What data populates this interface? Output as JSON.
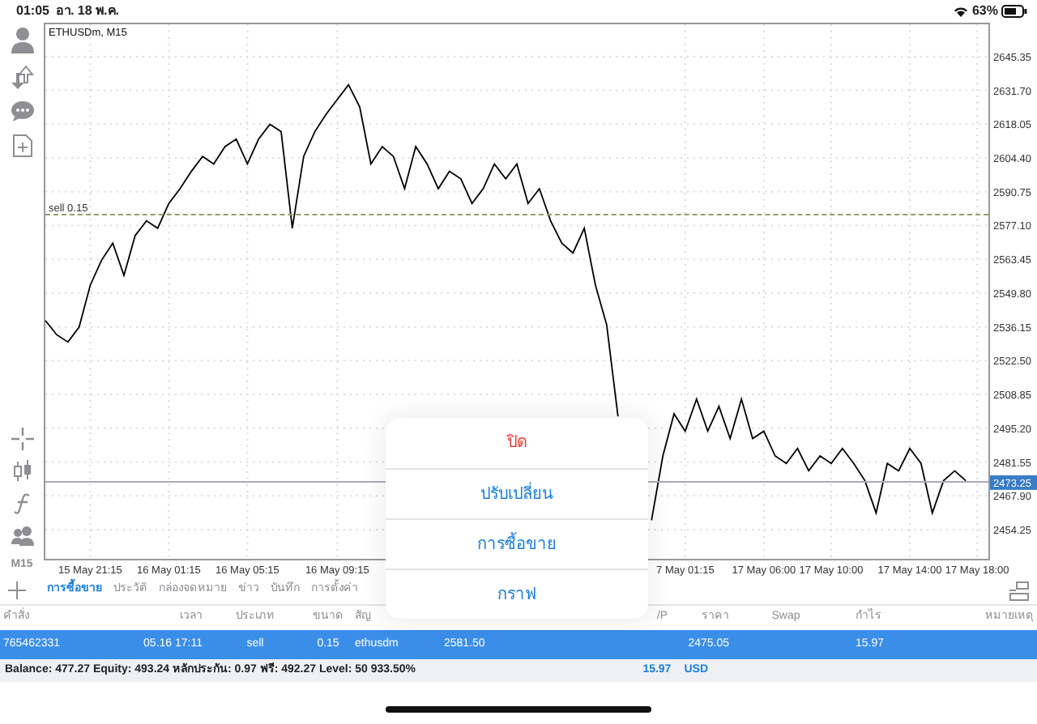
{
  "status_bar": {
    "time": "01:05",
    "date": "อา. 18 พ.ค.",
    "battery": "63%"
  },
  "toolbar": {
    "timeframe": "M15"
  },
  "chart": {
    "title": "ETHUSDm, M15",
    "order_label": "sell 0.15",
    "current_price": "2473.25",
    "chart_data": {
      "type": "line",
      "grid": true,
      "ylim": [
        2441.8,
        2658.4
      ],
      "categories": [
        null,
        null,
        null,
        null,
        "15 May 21:15",
        null,
        null,
        null,
        null,
        null,
        null,
        "16 May 01:15",
        null,
        null,
        null,
        null,
        null,
        null,
        "16 May 05:15",
        null,
        null,
        null,
        null,
        null,
        null,
        null,
        "16 May 09:15",
        null,
        null,
        null,
        null,
        null,
        null,
        null,
        null,
        null,
        null,
        null,
        null,
        null,
        null,
        null,
        null,
        null,
        null,
        null,
        null,
        null,
        null,
        null,
        null,
        null,
        null,
        null,
        null,
        null,
        null,
        "7 May 01:15",
        null,
        null,
        null,
        null,
        null,
        null,
        "17 May 06:00",
        null,
        null,
        null,
        null,
        null,
        "17 May 10:00",
        null,
        null,
        null,
        null,
        null,
        null,
        "17 May 14:00",
        null,
        null,
        null,
        null,
        null,
        "17 May 18:00"
      ],
      "yticks": [
        {
          "value": 2645.35,
          "label": "2645.35"
        },
        {
          "value": 2631.7,
          "label": "2631.70"
        },
        {
          "value": 2618.05,
          "label": "2618.05"
        },
        {
          "value": 2604.4,
          "label": "2604.40"
        },
        {
          "value": 2590.75,
          "label": "2590.75"
        },
        {
          "value": 2577.1,
          "label": "2577.10"
        },
        {
          "value": 2563.45,
          "label": "2563.45"
        },
        {
          "value": 2549.8,
          "label": "2549.80"
        },
        {
          "value": 2536.15,
          "label": "2536.15"
        },
        {
          "value": 2522.5,
          "label": "2522.50"
        },
        {
          "value": 2508.85,
          "label": "2508.85"
        },
        {
          "value": 2495.2,
          "label": "2495.20"
        },
        {
          "value": 2481.55,
          "label": "2481.55"
        },
        {
          "value": 2467.9,
          "label": "2467.90"
        },
        {
          "value": 2454.25,
          "label": "2454.25"
        }
      ],
      "series": [
        {
          "color": "#000000",
          "values": [
            2538.7,
            2533,
            2530,
            2536,
            2553,
            2563,
            2570,
            2557,
            2573,
            2579,
            2576,
            2586,
            2592,
            2599,
            2605,
            2602,
            2609,
            2612,
            2602,
            2612,
            2618,
            2615,
            2576,
            2605,
            2615,
            2622,
            2628,
            2634,
            2625,
            2602,
            2609,
            2605,
            2592,
            2609,
            2602,
            2592,
            2599,
            2596,
            2586,
            2592,
            2602,
            2596,
            2602,
            2586,
            2592,
            2579,
            2570,
            2566,
            2576,
            2553,
            2537,
            2500,
            null,
            null,
            2458,
            2484,
            2501,
            2494,
            2507,
            2494,
            2504,
            2491,
            2507,
            2491,
            2494,
            2484,
            2481,
            2487,
            2478,
            2484,
            2481,
            2487,
            2481,
            2474,
            2461,
            2481,
            2478,
            2487,
            2481,
            2461,
            2474,
            2478,
            2474,
            null
          ]
        }
      ]
    }
  },
  "tabs": [
    {
      "label": "การซื้อขาย",
      "selected": true
    },
    {
      "label": "ประวัติ",
      "selected": false
    },
    {
      "label": "กล่องจดหมาย",
      "selected": false
    },
    {
      "label": "ข่าว",
      "selected": false
    },
    {
      "label": "บันทึก",
      "selected": false
    },
    {
      "label": "การตั้งค่า",
      "selected": false
    }
  ],
  "table": {
    "columns": [
      "คำสั่ง",
      "เวลา",
      "ประเภท",
      "ขนาด",
      "สัญ",
      null,
      null,
      "/P",
      "ราคา",
      "Swap",
      "กำไร",
      "หมายเหตุ"
    ],
    "rows": [
      {
        "selected": true,
        "cells": [
          "765462331",
          "05.16 17:11",
          "sell",
          "0.15",
          "ethusdm",
          "2581.50",
          null,
          null,
          "2475.05",
          null,
          "15.97",
          null
        ]
      }
    ]
  },
  "summary": {
    "text": "Balance: 477.27 Equity: 493.24 หลักประกัน: 0.97 ฟรี: 492.27 Level: 50 933.50%",
    "profit": "15.97",
    "currency": "USD"
  },
  "popup": {
    "items": [
      {
        "label": "ปิด",
        "kind": "destructive"
      },
      {
        "label": "ปรับเปลี่ยน",
        "kind": "normal"
      },
      {
        "label": "การซื้อขาย",
        "kind": "normal"
      },
      {
        "label": "กราฟ",
        "kind": "normal"
      }
    ]
  }
}
